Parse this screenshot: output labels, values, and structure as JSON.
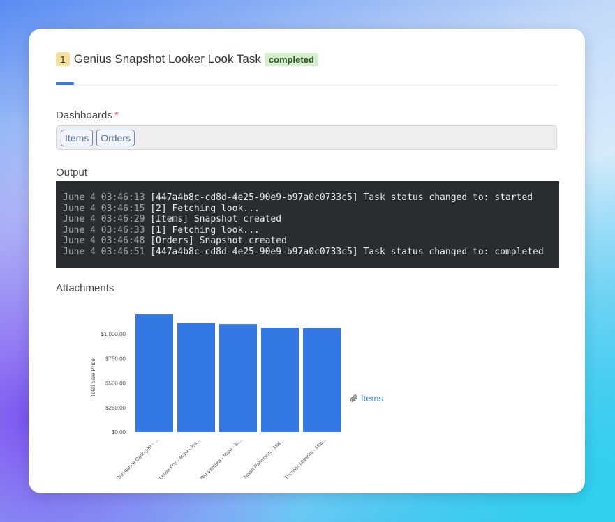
{
  "task": {
    "step": "1",
    "title": "Genius Snapshot Looker Look Task",
    "status": "completed"
  },
  "colors": {
    "accent": "#3b7be0",
    "bar": "#3478e3",
    "status_bg": "#d6efcf",
    "step_bg": "#f6e19b"
  },
  "dashboards": {
    "label": "Dashboards",
    "required_mark": "*",
    "chips": [
      "Items",
      "Orders"
    ]
  },
  "output": {
    "label": "Output",
    "lines": [
      {
        "ts": "June 4 03:46:13",
        "msg": "[447a4b8c-cd8d-4e25-90e9-b97a0c0733c5] Task status changed to: started"
      },
      {
        "ts": "June 4 03:46:15",
        "msg": "[2] Fetching look..."
      },
      {
        "ts": "June 4 03:46:29",
        "msg": "[Items] Snapshot created"
      },
      {
        "ts": "June 4 03:46:33",
        "msg": "[1] Fetching look..."
      },
      {
        "ts": "June 4 03:46:48",
        "msg": "[Orders] Snapshot created"
      },
      {
        "ts": "June 4 03:46:51",
        "msg": "[447a4b8c-cd8d-4e25-90e9-b97a0c0733c5] Task status changed to: completed"
      }
    ]
  },
  "attachments": {
    "label": "Attachments",
    "link_label": "Items",
    "link_icon": "paperclip-icon"
  },
  "chart_data": {
    "type": "bar",
    "ylabel": "Total Sale Price",
    "xlabel": "",
    "title": "",
    "categories": [
      "Constance Cadogan - ...",
      "Leslie Fox - Male - lea...",
      "Ted Ventura - Male - le...",
      "Jason Patterson - Mal...",
      "Thomas Mancini - Mal..."
    ],
    "values": [
      1200,
      1110,
      1100,
      1065,
      1060
    ],
    "ylim": [
      0,
      1250
    ],
    "yticks": [
      0,
      250,
      500,
      750,
      1000
    ],
    "ytick_labels": [
      "$0.00",
      "$250.00",
      "$500.00",
      "$750.00",
      "$1,000.00"
    ],
    "grid": false,
    "legend": "none"
  }
}
